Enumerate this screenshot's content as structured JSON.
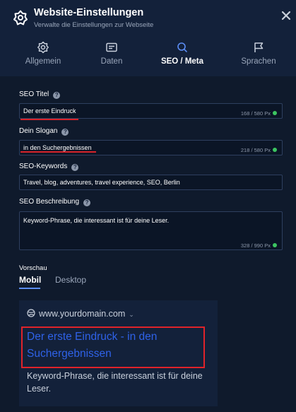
{
  "header": {
    "title": "Website-Einstellungen",
    "subtitle": "Verwalte die Einstellungen zur Webseite",
    "icon": "gear-flower-icon",
    "close_icon": "close-icon"
  },
  "tabs": [
    {
      "label": "Allgemein",
      "icon": "gear-icon",
      "active": false
    },
    {
      "label": "Daten",
      "icon": "id-card-icon",
      "active": false
    },
    {
      "label": "SEO / Meta",
      "icon": "search-icon",
      "active": true
    },
    {
      "label": "Sprachen",
      "icon": "flag-icon",
      "active": false
    }
  ],
  "form": {
    "seo_title": {
      "label": "SEO Titel",
      "value": "Der erste Eindruck",
      "counter": "168 / 580 Px"
    },
    "slogan": {
      "label": "Dein Slogan",
      "value": "in den Suchergebnissen",
      "counter": "218 / 580 Px"
    },
    "keywords": {
      "label": "SEO-Keywords",
      "value": "Travel, blog, adventures, travel experience, SEO, Berlin"
    },
    "description": {
      "label": "SEO Beschreibung",
      "value": "Keyword-Phrase, die interessant ist für deine Leser.",
      "counter": "328 / 990 Px"
    }
  },
  "preview": {
    "label": "Vorschau",
    "tabs": [
      "Mobil",
      "Desktop"
    ],
    "active_tab": "Mobil",
    "url": "www.yourdomain.com",
    "title": "Der erste Eindruck - in den Suchergebnissen",
    "description": "Keyword-Phrase, die interessant ist für deine Leser."
  },
  "colors": {
    "background": "#0f1a2c",
    "header": "#13213a",
    "accent": "#5b8df5",
    "link": "#2f62e8",
    "highlight_red": "#d8232a",
    "status_ok": "#3cc561"
  }
}
